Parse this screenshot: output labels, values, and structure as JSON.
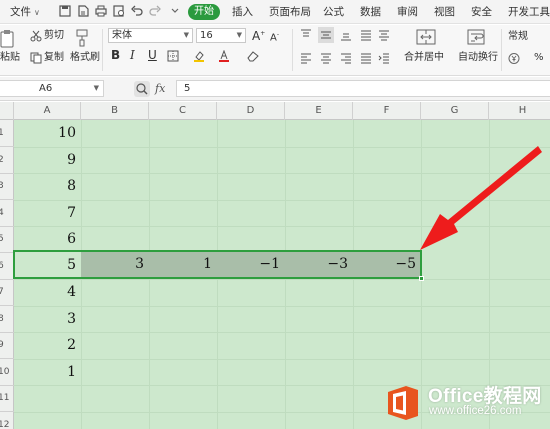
{
  "menu": {
    "file_label": "文件",
    "tabs": [
      "开始",
      "插入",
      "页面布局",
      "公式",
      "数据",
      "审阅",
      "视图",
      "安全",
      "开发工具"
    ],
    "active_tab": "开始",
    "active_color": "#2b9a3e"
  },
  "ribbon": {
    "paste_label": "粘贴",
    "cut_label": "剪切",
    "copy_label": "复制",
    "format_painter_label": "格式刷",
    "font_name": "宋体",
    "font_size": "16",
    "merge_label": "合并居中",
    "wrap_label": "自动换行",
    "number_format": "常规"
  },
  "formula_bar": {
    "cell_ref": "A6",
    "fx_label": "fx",
    "value": "5"
  },
  "sheet": {
    "columns": [
      "A",
      "B",
      "C",
      "D",
      "E",
      "F",
      "G",
      "H"
    ],
    "rows": [
      "1",
      "2",
      "3",
      "4",
      "5",
      "6",
      "7",
      "8",
      "9",
      "10",
      "11",
      "12"
    ],
    "col_a_values": [
      "10",
      "9",
      "8",
      "7",
      "6",
      "5",
      "4",
      "3",
      "2",
      "1"
    ],
    "row6_values": [
      "3",
      "1",
      "−1",
      "−3",
      "−5"
    ],
    "selection_color": "#2e9e3e",
    "background_color": "#cde8cd"
  },
  "annotation": {
    "arrow_color": "#ee1c1c"
  },
  "watermark": {
    "title": "Office教程网",
    "url": "www.office26.com",
    "logo_color": "#e8551e"
  }
}
